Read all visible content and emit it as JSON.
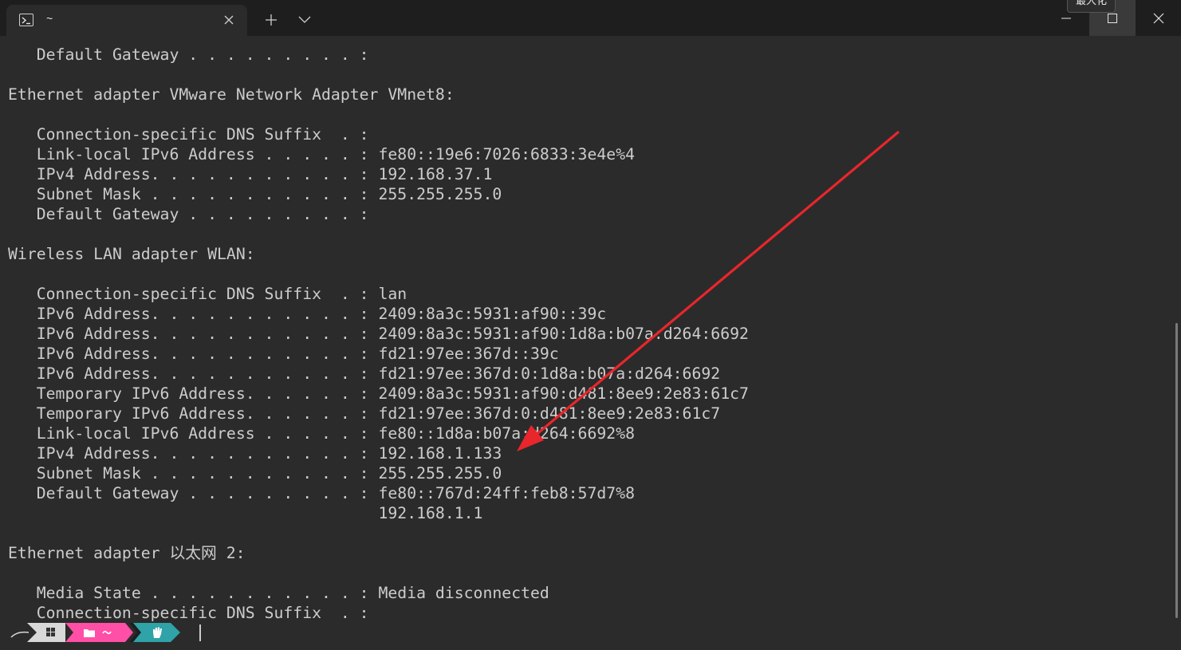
{
  "tab": {
    "title": "~",
    "icon": "powershell-icon"
  },
  "window": {
    "tooltip": "最大化"
  },
  "terminal": {
    "lines": [
      "   Default Gateway . . . . . . . . . :",
      "",
      "Ethernet adapter VMware Network Adapter VMnet8:",
      "",
      "   Connection-specific DNS Suffix  . :",
      "   Link-local IPv6 Address . . . . . : fe80::19e6:7026:6833:3e4e%4",
      "   IPv4 Address. . . . . . . . . . . : 192.168.37.1",
      "   Subnet Mask . . . . . . . . . . . : 255.255.255.0",
      "   Default Gateway . . . . . . . . . :",
      "",
      "Wireless LAN adapter WLAN:",
      "",
      "   Connection-specific DNS Suffix  . : lan",
      "   IPv6 Address. . . . . . . . . . . : 2409:8a3c:5931:af90::39c",
      "   IPv6 Address. . . . . . . . . . . : 2409:8a3c:5931:af90:1d8a:b07a:d264:6692",
      "   IPv6 Address. . . . . . . . . . . : fd21:97ee:367d::39c",
      "   IPv6 Address. . . . . . . . . . . : fd21:97ee:367d:0:1d8a:b07a:d264:6692",
      "   Temporary IPv6 Address. . . . . . : 2409:8a3c:5931:af90:d481:8ee9:2e83:61c7",
      "   Temporary IPv6 Address. . . . . . : fd21:97ee:367d:0:d481:8ee9:2e83:61c7",
      "   Link-local IPv6 Address . . . . . : fe80::1d8a:b07a:d264:6692%8",
      "   IPv4 Address. . . . . . . . . . . : 192.168.1.133",
      "   Subnet Mask . . . . . . . . . . . : 255.255.255.0",
      "   Default Gateway . . . . . . . . . : fe80::767d:24ff:feb8:57d7%8",
      "                                       192.168.1.1",
      "",
      "Ethernet adapter 以太网 2:",
      "",
      "   Media State . . . . . . . . . . . : Media disconnected",
      "   Connection-specific DNS Suffix  . :"
    ]
  },
  "colors": {
    "background": "#2b2b2b",
    "titlebar": "#1e1e1e",
    "text": "#cccccc",
    "arrow": "#e8262b",
    "prompt_os": "#d8d8d8",
    "prompt_path": "#ff4fa6",
    "prompt_git": "#2fa3a8"
  },
  "prompt": {
    "segments": [
      "windows-logo-icon",
      "folder-icon",
      "hand-icon"
    ]
  }
}
